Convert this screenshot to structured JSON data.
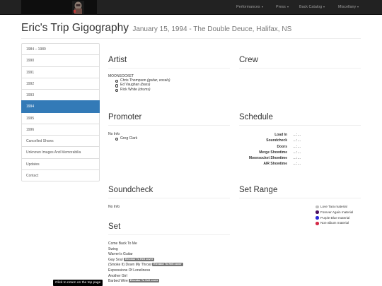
{
  "nav": {
    "logo": "logo-icon",
    "menus": [
      {
        "label": "Performances"
      },
      {
        "label": "Press"
      },
      {
        "label": "Back Catalog"
      },
      {
        "label": "Miscellany"
      }
    ]
  },
  "page": {
    "title": "Eric's Trip Gigography",
    "subtitle": "January 15, 1994 - The Double Deuce, Halifax, NS"
  },
  "sidebar": {
    "items": [
      {
        "label": "1984 – 1989"
      },
      {
        "label": "1990"
      },
      {
        "label": "1991"
      },
      {
        "label": "1992"
      },
      {
        "label": "1993"
      },
      {
        "label": "1994"
      },
      {
        "label": "1995"
      },
      {
        "label": "1996"
      },
      {
        "label": "Cancelled Shows"
      },
      {
        "label": "Unknown Images And Memorabilia"
      },
      {
        "label": "Updates"
      },
      {
        "label": "Contact"
      }
    ],
    "active_color": "#337ab7"
  },
  "artist": {
    "heading": "Artist",
    "band": "MOONSOCKET",
    "members": [
      {
        "name": "Chris Thompson",
        "role": "(guitar, vocals)"
      },
      {
        "name": "Ed Vaughan",
        "role": "(bass)"
      },
      {
        "name": "Rick White",
        "role": "(drums)"
      }
    ]
  },
  "crew": {
    "heading": "Crew"
  },
  "promoter": {
    "heading": "Promoter",
    "info": "No Info",
    "people": [
      "Greg Clark"
    ]
  },
  "schedule": {
    "heading": "Schedule",
    "rows": [
      {
        "label": "Load In",
        "value": "…:…"
      },
      {
        "label": "Soundcheck",
        "value": "…:…"
      },
      {
        "label": "Doors",
        "value": "…:…"
      },
      {
        "label": "Merge Showtime",
        "value": "…:…"
      },
      {
        "label": "Moonsocket Showtime",
        "value": "…:…"
      },
      {
        "label": "AIR Showtime",
        "value": "…:…"
      }
    ]
  },
  "soundcheck": {
    "heading": "Soundcheck",
    "info": "No Info"
  },
  "setrange": {
    "heading": "Set Range",
    "legend": [
      {
        "label": "Love Tara material",
        "color": "#c0c0c0"
      },
      {
        "label": "Forever Again material",
        "color": "#4b0f5e"
      },
      {
        "label": "Purple Blue material",
        "color": "#2a2ad6"
      },
      {
        "label": "Non-album material",
        "color": "#d42a48"
      }
    ]
  },
  "set": {
    "heading": "Set",
    "songs": [
      {
        "title": "Come Back To Me",
        "badge": ""
      },
      {
        "title": "Swing",
        "badge": ""
      },
      {
        "title": "Warren's Guitar",
        "badge": ""
      },
      {
        "title": "Gay Soul",
        "badge": "Elevator To Hell cover"
      },
      {
        "title": "(Smoke It) Down My Throat",
        "badge": "Elevator To Hell cover"
      },
      {
        "title": "Expressions Of Loneliness",
        "badge": ""
      },
      {
        "title": "Another Girl",
        "badge": ""
      },
      {
        "title": "Barbed Wire",
        "badge": "Elevator To Hell cover"
      }
    ]
  },
  "backtop": {
    "label": "Click to return on the top page"
  }
}
